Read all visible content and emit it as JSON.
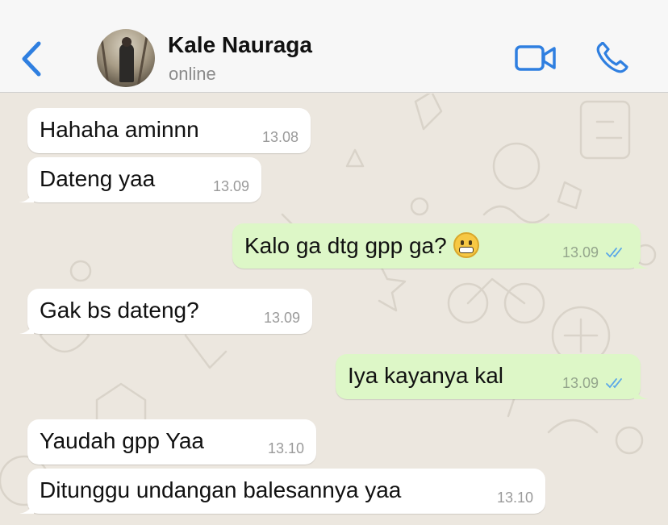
{
  "contact": {
    "name": "Kale Nauraga",
    "status": "online"
  },
  "icons": {
    "back": "chevron-left-icon",
    "video": "video-camera-icon",
    "phone": "phone-icon",
    "read_receipt": "double-check-icon"
  },
  "colors": {
    "accent": "#2F7FE0",
    "incoming_bubble": "#FFFFFF",
    "outgoing_bubble": "#DDF7C7",
    "read_check": "#5AA7E8",
    "wallpaper": "#ECE7DF"
  },
  "messages": [
    {
      "direction": "incoming",
      "text": "Hahaha aminnn",
      "time": "13.08"
    },
    {
      "direction": "incoming",
      "text": "Dateng yaa",
      "time": "13.09"
    },
    {
      "direction": "outgoing",
      "text": "Kalo ga dtg gpp ga?",
      "emoji": "grimacing-face-emoji",
      "time": "13.09",
      "read": true
    },
    {
      "direction": "incoming",
      "text": "Gak bs dateng?",
      "time": "13.09"
    },
    {
      "direction": "outgoing",
      "text": "Iya kayanya kal",
      "time": "13.09",
      "read": true
    },
    {
      "direction": "incoming",
      "text": "Yaudah gpp Yaa",
      "time": "13.10"
    },
    {
      "direction": "incoming",
      "text": "Ditunggu undangan balesannya yaa",
      "time": "13.10"
    }
  ]
}
